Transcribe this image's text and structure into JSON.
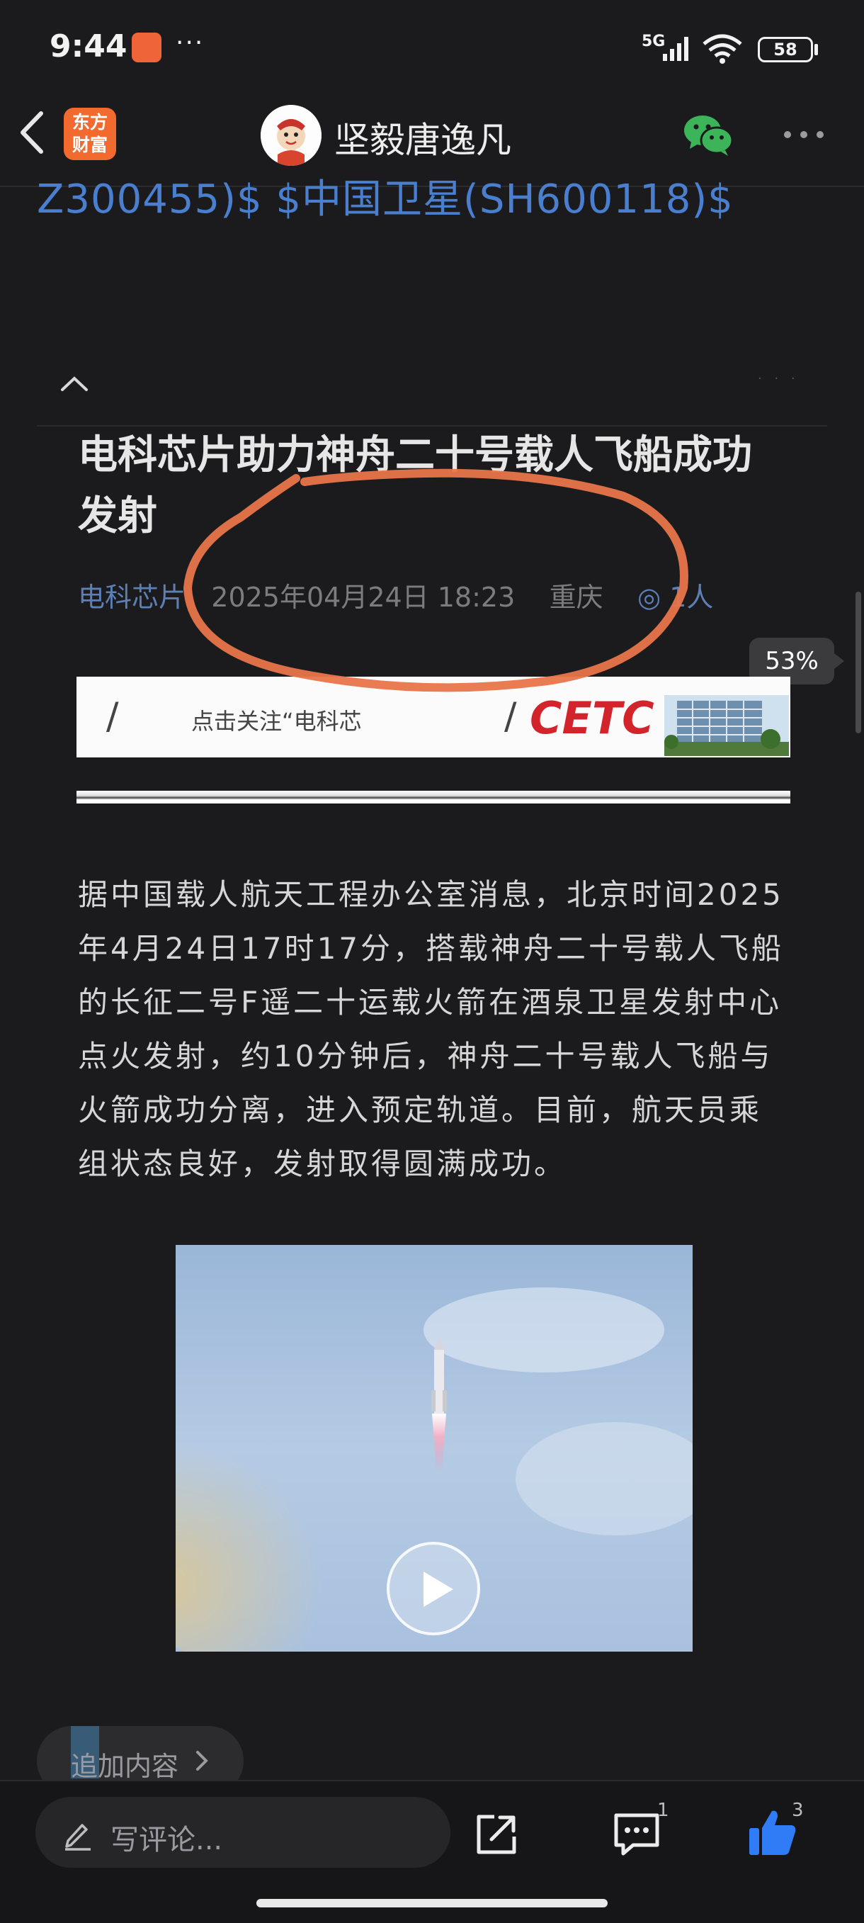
{
  "status_bar": {
    "time": "9:44",
    "more": "···",
    "network": "5G",
    "battery": "58"
  },
  "nav": {
    "app_logo_text": "东方财富",
    "title": "坚毅唐逸凡"
  },
  "stock_tags": "Z300455)$  $中国卫星(SH600118)$",
  "article": {
    "title": "电科芯片助力神舟二十号载人飞船成功发射",
    "meta": {
      "source": "电科芯片",
      "date": "2025年04月24日 18:23",
      "location": "重庆",
      "readers": "1人"
    },
    "banner": {
      "text": "点击关注“电科芯",
      "logo": "CETC"
    },
    "body": "据中国载人航天工程办公室消息，北京时间2025年4月24日17时17分，搭载神舟二十号载人飞船的长征二号F遥二十运载火箭在酒泉卫星发射中心点火发射，约10分钟后，神舟二十号载人飞船与火箭成功分离，进入预定轨道。目前，航天员乘组状态良好，发射取得圆满成功。"
  },
  "reading_progress": "53%",
  "append_button": "追加内容",
  "bottom_bar": {
    "comment_placeholder": "写评论...",
    "comment_count": "1",
    "like_count": "3"
  },
  "colors": {
    "background": "#1b1b1d",
    "link_blue": "#4a7fd0",
    "annotation_orange": "#e8754a",
    "like_blue": "#2f7cf6",
    "wechat_green": "#3cb55a"
  }
}
